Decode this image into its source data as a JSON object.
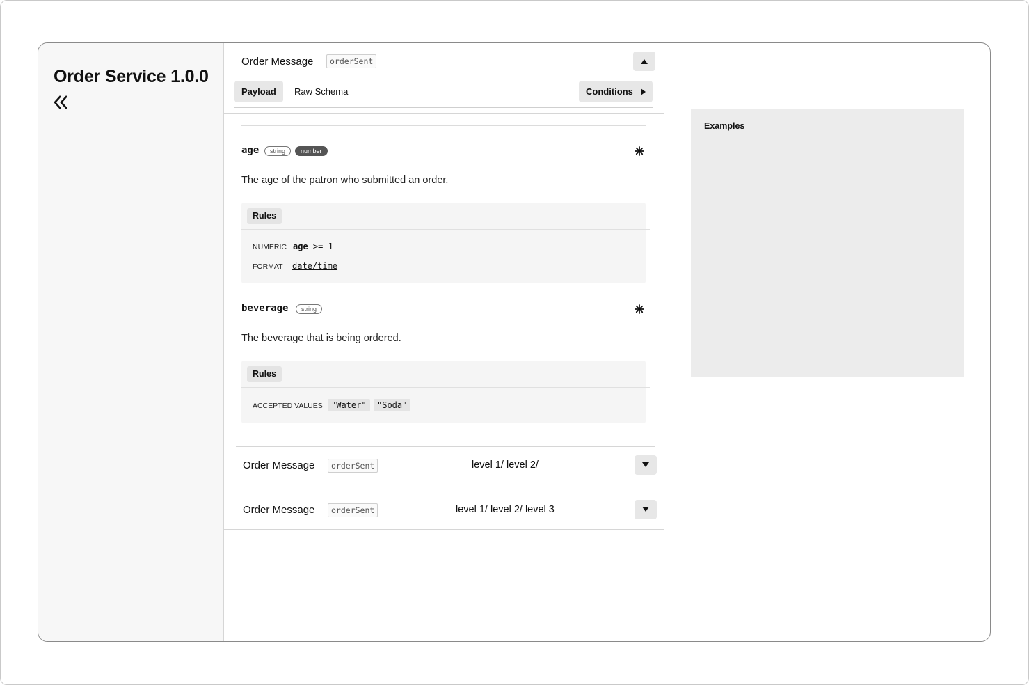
{
  "app": {
    "title": "Order Service 1.0.0"
  },
  "sidebar": {
    "collapse_icon": "double-chevron-left-icon"
  },
  "message": {
    "title": "Order Message",
    "code": "orderSent",
    "toggle_icon": "caret-up-icon",
    "tabs": [
      {
        "label": "Payload",
        "active": true
      },
      {
        "label": "Raw Schema",
        "active": false
      }
    ],
    "conditions_label": "Conditions",
    "conditions_icon": "caret-right-icon"
  },
  "fields": [
    {
      "name": "age",
      "types": [
        "string",
        "number"
      ],
      "required_icon": "asterisk-icon",
      "description": "The age of the patron who submitted an order.",
      "rules_label": "Rules",
      "rules": [
        {
          "key": "NUMERIC",
          "value_name": "age",
          "value_rest": ">= 1"
        },
        {
          "key": "FORMAT",
          "value": "date/time"
        }
      ]
    },
    {
      "name": "beverage",
      "types": [
        "string"
      ],
      "required_icon": "asterisk-icon",
      "description": "The beverage that is being ordered.",
      "rules_label": "Rules",
      "accepted_key": "ACCEPTED VALUES",
      "accepted_values": [
        "\"Water\"",
        "\"Soda\""
      ]
    }
  ],
  "collapsed_messages": [
    {
      "title": "Order Message",
      "code": "orderSent",
      "path": "level 1/ level 2/",
      "toggle_icon": "caret-down-icon"
    },
    {
      "title": "Order Message",
      "code": "orderSent",
      "path": "level 1/ level 2/ level 3",
      "toggle_icon": "caret-down-icon"
    }
  ],
  "examples": {
    "title": "Examples"
  },
  "colors": {
    "sidebar_bg": "#f7f7f7",
    "chip_bg": "#e7e7e7",
    "examples_bg": "#ececec",
    "badge_filled": "#555555"
  }
}
